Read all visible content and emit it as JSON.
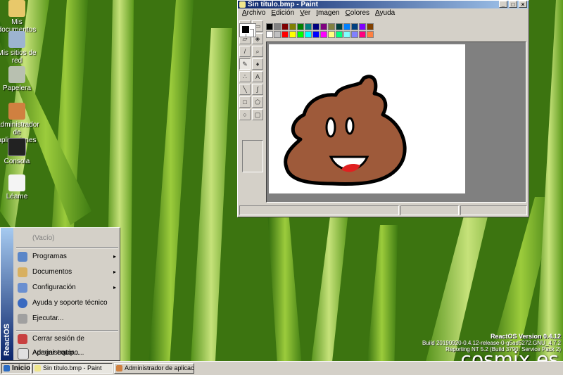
{
  "desktop": {
    "icons": [
      {
        "label": "Mis documentos",
        "icon": "folder-documents-icon"
      },
      {
        "label": "Mis sitios de red",
        "icon": "network-icon"
      },
      {
        "label": "Papelera",
        "icon": "recycle-bin-icon"
      },
      {
        "label": "Administrador de aplicaciones",
        "icon": "app-manager-icon"
      },
      {
        "label": "Consola",
        "icon": "console-icon"
      },
      {
        "label": "Léame",
        "icon": "readme-icon"
      }
    ]
  },
  "paint": {
    "title": "Sin título.bmp - Paint",
    "menu": [
      "Archivo",
      "Edición",
      "Ver",
      "Imagen",
      "Colores",
      "Ayuda"
    ],
    "palette_row1": [
      "#000000",
      "#808080",
      "#800000",
      "#808000",
      "#008000",
      "#008080",
      "#000080",
      "#800080",
      "#808040",
      "#004040",
      "#0080ff",
      "#004080",
      "#8000ff",
      "#804000"
    ],
    "palette_row2": [
      "#ffffff",
      "#c0c0c0",
      "#ff0000",
      "#ffff00",
      "#00ff00",
      "#00ffff",
      "#0000ff",
      "#ff00ff",
      "#ffff80",
      "#00ff80",
      "#80ffff",
      "#8080ff",
      "#ff0080",
      "#ff8040"
    ],
    "drawing": "poop-emoji-drawing"
  },
  "startmenu": {
    "banner": "ReactOS",
    "empty": "(Vacío)",
    "items": [
      {
        "label": "Programas",
        "arrow": "▸"
      },
      {
        "label": "Documentos",
        "arrow": "▸"
      },
      {
        "label": "Configuración",
        "arrow": "▸"
      },
      {
        "label": "Ayuda y soporte técnico",
        "arrow": ""
      },
      {
        "label": "Ejecutar...",
        "arrow": ""
      },
      {
        "label": "Cerrar sesión de Administrator...",
        "arrow": ""
      },
      {
        "label": "Apagar equipo...",
        "arrow": ""
      }
    ]
  },
  "taskbar": {
    "start": "Inicio",
    "tasks": [
      "Sin título.bmp - Paint",
      "Administrador de aplicacio..."
    ]
  },
  "version": {
    "line1": "ReactOS Version 0.4.12",
    "line2": "Build 20190920-0.4.12-release-0-g5ad5272.GNU_4.7.2",
    "line3": "Reporting NT 5.2 (Build 3790: Service Pack 2)"
  },
  "watermark": "cosmix.es"
}
